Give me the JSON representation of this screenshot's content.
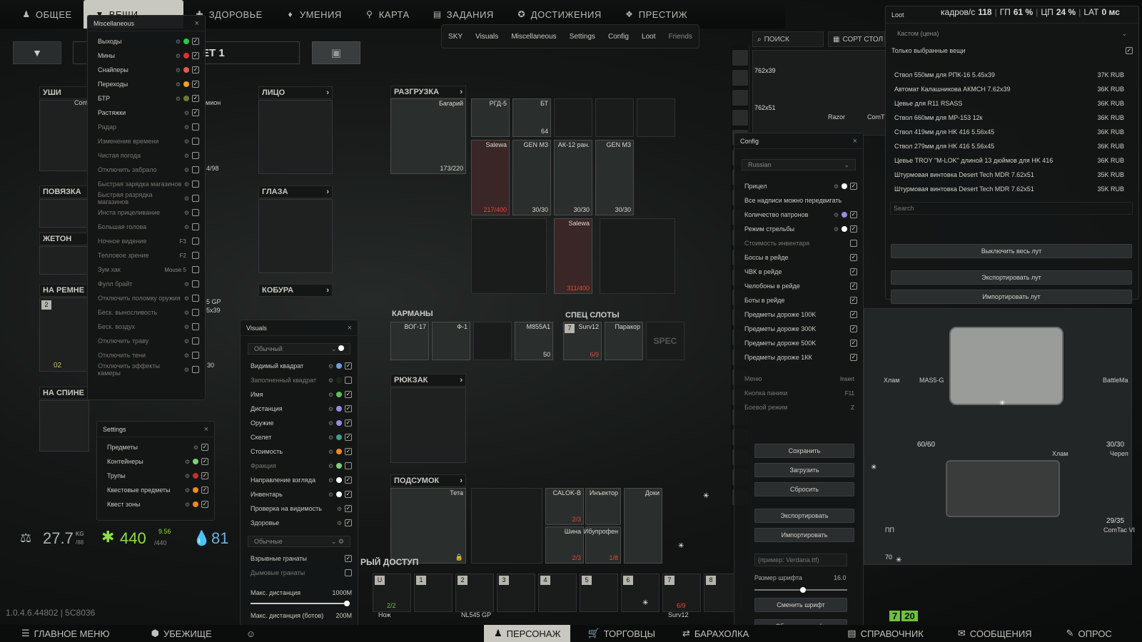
{
  "topnav": {
    "tabs": [
      {
        "label": "ОБЩЕЕ",
        "icon": "person-icon"
      },
      {
        "label": "ВЕЩИ",
        "icon": "shirt-icon",
        "active": true
      },
      {
        "label": "ЗДОРОВЬЕ",
        "icon": "health-icon"
      },
      {
        "label": "УМЕНИЯ",
        "icon": "skills-icon"
      },
      {
        "label": "КАРТА",
        "icon": "map-pin-icon"
      },
      {
        "label": "ЗАДАНИЯ",
        "icon": "tasks-icon"
      },
      {
        "label": "ДОСТИЖЕНИЯ",
        "icon": "achievement-icon"
      },
      {
        "label": "ПРЕСТИЖ",
        "icon": "prestige-icon"
      }
    ]
  },
  "submenu": {
    "items": [
      "SKY",
      "Visuals",
      "Miscellaneous",
      "Settings",
      "Config",
      "Loot",
      "Friends"
    ]
  },
  "misc": {
    "title": "Miscellaneous",
    "rows": [
      {
        "label": "Выходы",
        "dot": "#2ec940",
        "checked": true
      },
      {
        "label": "Мины",
        "dot": "#e0332b",
        "checked": true
      },
      {
        "label": "Снайперы",
        "dot": "#e05a50",
        "checked": true
      },
      {
        "label": "Переходы",
        "dot": "#f0a020",
        "checked": true
      },
      {
        "label": "БТР",
        "dot": "#6f7a3a",
        "checked": true
      },
      {
        "label": "Растяжки",
        "dot": "",
        "checked": true
      },
      {
        "label": "Радар",
        "dot": "",
        "checked": false,
        "dim": true
      },
      {
        "label": "Изменение времени",
        "dot": "",
        "checked": false,
        "dim": true
      },
      {
        "label": "Чистая погода",
        "dot": "",
        "checked": false,
        "dim": true
      },
      {
        "label": "Отключить забрало",
        "dot": "",
        "checked": false,
        "dim": true
      },
      {
        "label": "Быстрая зарядка магазинов",
        "dot": "",
        "checked": false,
        "dim": true
      },
      {
        "label": "Быстрая разрядка магазинов",
        "dot": "",
        "checked": false,
        "dim": true
      },
      {
        "label": "Инста прицеливание",
        "dot": "",
        "checked": false,
        "dim": true
      },
      {
        "label": "Большая голова",
        "dot": "",
        "checked": false,
        "dim": true
      },
      {
        "label": "Ночное видение",
        "key": "F3",
        "checked": false,
        "dim": true
      },
      {
        "label": "Тепловое зрение",
        "key": "F2",
        "checked": false,
        "dim": true
      },
      {
        "label": "Зум хак",
        "key": "Mouse 5",
        "checked": false,
        "dim": true
      },
      {
        "label": "Фулл брайт",
        "dot": "",
        "checked": false,
        "dim": true
      },
      {
        "label": "Отключить поломку оружия",
        "dot": "",
        "checked": false,
        "dim": true
      },
      {
        "label": "Беск. выносливость",
        "dot": "",
        "checked": false,
        "dim": true
      },
      {
        "label": "Беск. воздух",
        "dot": "",
        "checked": false,
        "dim": true
      },
      {
        "label": "Отключить траву",
        "dot": "",
        "checked": false,
        "dim": true
      },
      {
        "label": "Отключить тени",
        "dot": "",
        "checked": false,
        "dim": true
      },
      {
        "label": "Отключить эффекты камеры",
        "dot": "",
        "checked": false,
        "dim": true
      }
    ]
  },
  "settings": {
    "title": "Settings",
    "rows": [
      {
        "label": "Предметы",
        "dot": "",
        "checked": true
      },
      {
        "label": "Контейнеры",
        "dot": "#7fd07a",
        "checked": true
      },
      {
        "label": "Трупы",
        "dot": "#c03030",
        "checked": true
      },
      {
        "label": "Квестовые предметы",
        "dot": "#f08a20",
        "checked": true
      },
      {
        "label": "Квест зоны",
        "dot": "#f08a20",
        "checked": true
      }
    ]
  },
  "visuals": {
    "title": "Visuals",
    "dropdown1": "Обычный",
    "dropdown2": "Обычные",
    "rows": [
      {
        "label": "Видимый квадрат",
        "dot": "#6fa0e0",
        "checked": true
      },
      {
        "label": "Заполненный квадрат",
        "dot": "#222",
        "checked": false,
        "dim": true
      },
      {
        "label": "Имя",
        "dot": "#5ac050",
        "checked": true
      },
      {
        "label": "Дистанция",
        "dot": "#9a8ae0",
        "checked": true
      },
      {
        "label": "Оружие",
        "dot": "#9a8ae0",
        "checked": true
      },
      {
        "label": "Скелет",
        "dot": "#3aa090",
        "checked": true
      },
      {
        "label": "Стоимость",
        "dot": "#f08a20",
        "checked": true
      },
      {
        "label": "Фракция",
        "dot": "#7fd07a",
        "checked": false,
        "dim": true
      },
      {
        "label": "Направление взгляда",
        "dot": "#ffffff",
        "checked": true
      },
      {
        "label": "Инвентарь",
        "dot": "#ffffff",
        "checked": true
      },
      {
        "label": "Проверка на видимость",
        "dot": "",
        "checked": true
      },
      {
        "label": "Здоровье",
        "dot": "",
        "checked": true
      }
    ],
    "rows2": [
      {
        "label": "Взрывные гранаты",
        "checked": true
      },
      {
        "label": "Дымовые гранаты",
        "checked": false,
        "dim": true
      }
    ],
    "maxdist_label": "Макс. дистанция",
    "maxdist_value": "1000M",
    "maxdist_bots_label": "Макс. дистанция (ботов)",
    "maxdist_bots_value": "200M"
  },
  "config": {
    "title": "Config",
    "language": "Russian",
    "rows": [
      {
        "label": "Прицел",
        "dot": "#ffffff",
        "checked": true
      },
      {
        "label": "Все надписи можно передвигать"
      },
      {
        "label": "Количество патронов",
        "dot": "#9a8ae0",
        "checked": true
      },
      {
        "label": "Режим стрельбы",
        "dot": "#ffffff",
        "checked": true
      },
      {
        "label": "Стоимость инвентаря",
        "checked": false,
        "dim": true
      },
      {
        "label": "Боссы в рейде",
        "checked": true
      },
      {
        "label": "ЧВК в рейде",
        "checked": true
      },
      {
        "label": "Челобоны в рейде",
        "checked": true
      },
      {
        "label": "Боты в рейде",
        "checked": true
      },
      {
        "label": "Предметы дороже 100K",
        "checked": true
      },
      {
        "label": "Предметы дороже 300K",
        "checked": true
      },
      {
        "label": "Предметы дороже 500K",
        "checked": true
      },
      {
        "label": "Предметы дороже 1КК",
        "checked": true
      }
    ],
    "keys": [
      {
        "label": "Меню",
        "key": "Insert"
      },
      {
        "label": "Кнопка паники",
        "key": "F11"
      },
      {
        "label": "Боевой режим",
        "key": "Z"
      }
    ],
    "buttons": {
      "save": "Сохранить",
      "load": "Загрузить",
      "reset": "Сбросить",
      "export": "Экспортировать",
      "import": "Импортировать",
      "change_font": "Сменить шрифт",
      "reset_font": "Сбросить шрифт"
    },
    "font_placeholder": "(пример: Verdana.ttf)",
    "font_size_label": "Размер шрифта",
    "font_size_value": "16.0"
  },
  "loot": {
    "title": "Loot",
    "stats": {
      "fps_label": "кадров/с",
      "fps": "118",
      "gpu_label": "ГП",
      "gpu": "61 %",
      "cpu_label": "ЦП",
      "cpu": "24 %",
      "lat_label": "LAT",
      "lat": "0 мс"
    },
    "sort_label": "Кастом (цена)",
    "only_selected": "Только выбранные вещи",
    "items": [
      {
        "name": "Ствол 550мм для РПК-16 5.45x39",
        "price": "37K RUB"
      },
      {
        "name": "Автомат Калашникова АКМСН 7.62x39",
        "price": "36K RUB"
      },
      {
        "name": "Цевье для R11 RSASS",
        "price": "36K RUB"
      },
      {
        "name": "Ствол 660мм для MP-153 12к",
        "price": "36K RUB"
      },
      {
        "name": "Ствол 419мм для HK 416 5.56x45",
        "price": "36K RUB"
      },
      {
        "name": "Ствол 279мм для HK 416 5.56x45",
        "price": "36K RUB"
      },
      {
        "name": "Цевье TROY \"M-LOK\" длиной 13 дюймов для HK 416",
        "price": "36K RUB"
      },
      {
        "name": "Штурмовая винтовка Desert Tech MDR 7.62x51",
        "price": "35K RUB"
      },
      {
        "name": "Штурмовая винтовка Desert Tech MDR 7.62x51",
        "price": "35K RUB"
      }
    ],
    "search_placeholder": "Search",
    "disable_all": "Выключить весь лут",
    "export": "Экспортировать лут",
    "import": "Импортировать лут"
  },
  "stash": {
    "search": "ПОИСК",
    "sort": "СОРТ СТОЛ",
    "w1": "762x39",
    "w2": "762x51",
    "razor": "Razor",
    "comt": "ComT",
    "hlam1": "Хлам",
    "mas": "MAS5-G",
    "battlem": "BattleMa",
    "hlam2": "Хлам",
    "cherep": "Череп",
    "ammo1": "60/60",
    "ammo2": "30/30",
    "comtac": "ComTac VI",
    "count1": "29/35",
    "num70": "70",
    "pp": "ПП"
  },
  "gear": {
    "preset": "ЕТ 1",
    "labels": {
      "ushi": "УШИ",
      "litso": "ЛИЦО",
      "povyazka": "ПОВЯЗКА",
      "glaza": "ГЛАЗА",
      "zheton": "ЖЕТОН",
      "na_remne": "НА РЕМНЕ",
      "kobura": "КОБУРА",
      "na_spine": "НА СПИНЕ",
      "razgruzka": "РАЗГРУЗКА",
      "karmany": "КАРМАНЫ",
      "spec": "СПЕЦ СЛОТЫ",
      "ryukzak": "РЮКЗАК",
      "podsumok": "ПОДСУМОК",
      "fast": "РЫЙ ДОСТУП"
    },
    "texts": {
      "com": "Com",
      "mion": "мион",
      "dur": "4/98",
      "sp": "5 GP",
      "x39": "5x39",
      "n30": "30",
      "n2": "2",
      "n02": "02",
      "bagariy": "Багарий",
      "bagariy_dur": "173/220",
      "rgd": "РГД-5",
      "bt": "БТ",
      "bt_ct": "64",
      "salewa": "Salewa",
      "salewa_ct": "217/400",
      "gen1": "GEN M3",
      "gen1_ct": "30/30",
      "ak": "АК-12 ран.",
      "ak_ct": "30/30",
      "gen2": "GEN M3",
      "gen2_ct": "30/30",
      "salewa2": "Salewa",
      "salewa2_ct": "311/400",
      "vog": "ВОГ-17",
      "f1": "Ф-1",
      "m855": "M855A1",
      "m855_ct": "50",
      "surv": "Surv12",
      "surv_ct": "6/9",
      "parakor": "Паракор",
      "specl": "SPEC",
      "teta": "Тета",
      "calok": "CALOK-B",
      "calok_ct": "2/3",
      "inj": "Инъектор",
      "shina": "Шина",
      "shina_ct": "2/3",
      "ibu": "Ибупрофен",
      "ibu_ct": "1/8",
      "doki": "Доки"
    },
    "hotbar": [
      {
        "k": "U",
        "label": "Нож",
        "ct": "2/2"
      },
      {
        "k": "1",
        "label": ""
      },
      {
        "k": "2",
        "label": "NL545 GP"
      },
      {
        "k": "3",
        "label": ""
      },
      {
        "k": "4",
        "label": ""
      },
      {
        "k": "5",
        "label": ""
      },
      {
        "k": "6",
        "label": ""
      },
      {
        "k": "7",
        "label": "Surv12",
        "ct": "6/9"
      },
      {
        "k": "8",
        "label": ""
      }
    ],
    "seven": "7"
  },
  "stats": {
    "weight": "27.7",
    "weight_unit": "KG",
    "weight_max": "/88",
    "energy": "440",
    "energy_top": "9.56",
    "energy_max": "/440",
    "hydration": "81",
    "version": "1.0.4.6.44802 | 5C8036"
  },
  "badge": {
    "a": "7",
    "b": "20"
  },
  "bottomnav": {
    "items": [
      {
        "label": "ГЛАВНОЕ МЕНЮ",
        "icon": "menu-icon"
      },
      {
        "label": "УБЕЖИЩЕ",
        "icon": "hideout-icon"
      },
      {
        "label": "",
        "icon": "character-icon"
      },
      {
        "label": "ПЕРСОНАЖ",
        "icon": "person-icon",
        "active": true
      },
      {
        "label": "ТОРГОВЦЫ",
        "icon": "cart-icon"
      },
      {
        "label": "БАРАХОЛКА",
        "icon": "flea-icon"
      },
      {
        "label": "СПРАВОЧНИК",
        "icon": "book-icon"
      },
      {
        "label": "СООБЩЕНИЯ",
        "icon": "message-icon"
      },
      {
        "label": "ОПРОС",
        "icon": "survey-icon"
      }
    ]
  }
}
